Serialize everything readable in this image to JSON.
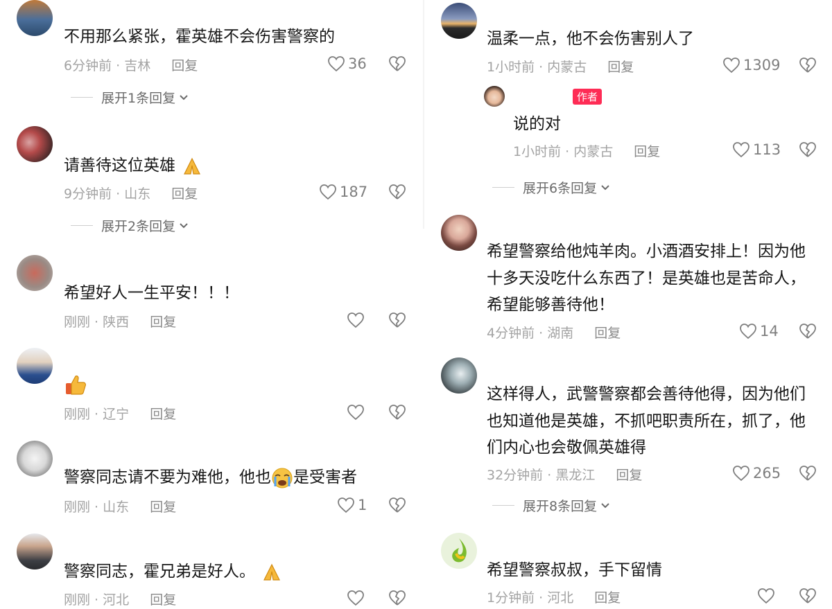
{
  "left_comments": [
    {
      "text": "不用那么紧张，霍英雄不会伤害警察的",
      "time": "6分钟前",
      "location": "吉林",
      "reply": "回复",
      "likes": "36",
      "expand": "展开1条回复"
    },
    {
      "text": "请善待这位英雄",
      "time": "9分钟前",
      "location": "山东",
      "reply": "回复",
      "likes": "187",
      "expand": "展开2条回复"
    },
    {
      "text": "希望好人一生平安！！！",
      "time": "刚刚",
      "location": "陕西",
      "reply": "回复",
      "likes": ""
    },
    {
      "text": "",
      "time": "刚刚",
      "location": "辽宁",
      "reply": "回复",
      "likes": ""
    },
    {
      "text_a": "警察同志请不要为难他，他也",
      "text_b": "是受害者",
      "time": "刚刚",
      "location": "山东",
      "reply": "回复",
      "likes": "1"
    },
    {
      "text": "警察同志，霍兄弟是好人。",
      "time": "刚刚",
      "location": "河北",
      "reply": "回复",
      "likes": ""
    }
  ],
  "right_comments": [
    {
      "text": "温柔一点，他不会伤害别人了",
      "time": "1小时前",
      "location": "内蒙古",
      "reply": "回复",
      "likes": "1309"
    },
    {
      "author_tag": "作者",
      "text": "说的对",
      "time": "1小时前",
      "location": "内蒙古",
      "reply": "回复",
      "likes": "113",
      "expand": "展开6条回复"
    },
    {
      "lines": [
        "希望警察给他炖羊肉。小酒酒安排上！因为他",
        "十多天没吃什么东西了！是英雄也是苦命人，",
        "希望能够善待他！"
      ],
      "time": "4分钟前",
      "location": "湖南",
      "reply": "回复",
      "likes": "14"
    },
    {
      "lines": [
        "这样得人，武警警察都会善待他得，因为他们",
        "也知道他是英雄，不抓吧职责所在，抓了，他",
        "们内心也会敬佩英雄得"
      ],
      "time": "32分钟前",
      "location": "黑龙江",
      "reply": "回复",
      "likes": "265",
      "expand": "展开8条回复"
    },
    {
      "text": "希望警察叔叔，手下留情",
      "time": "1分钟前",
      "location": "河北",
      "reply": "回复",
      "likes": ""
    }
  ],
  "separator": " · ",
  "colors": {
    "author_tag": "#fe2c55",
    "meta": "#a3a3a3",
    "text": "#161616"
  }
}
